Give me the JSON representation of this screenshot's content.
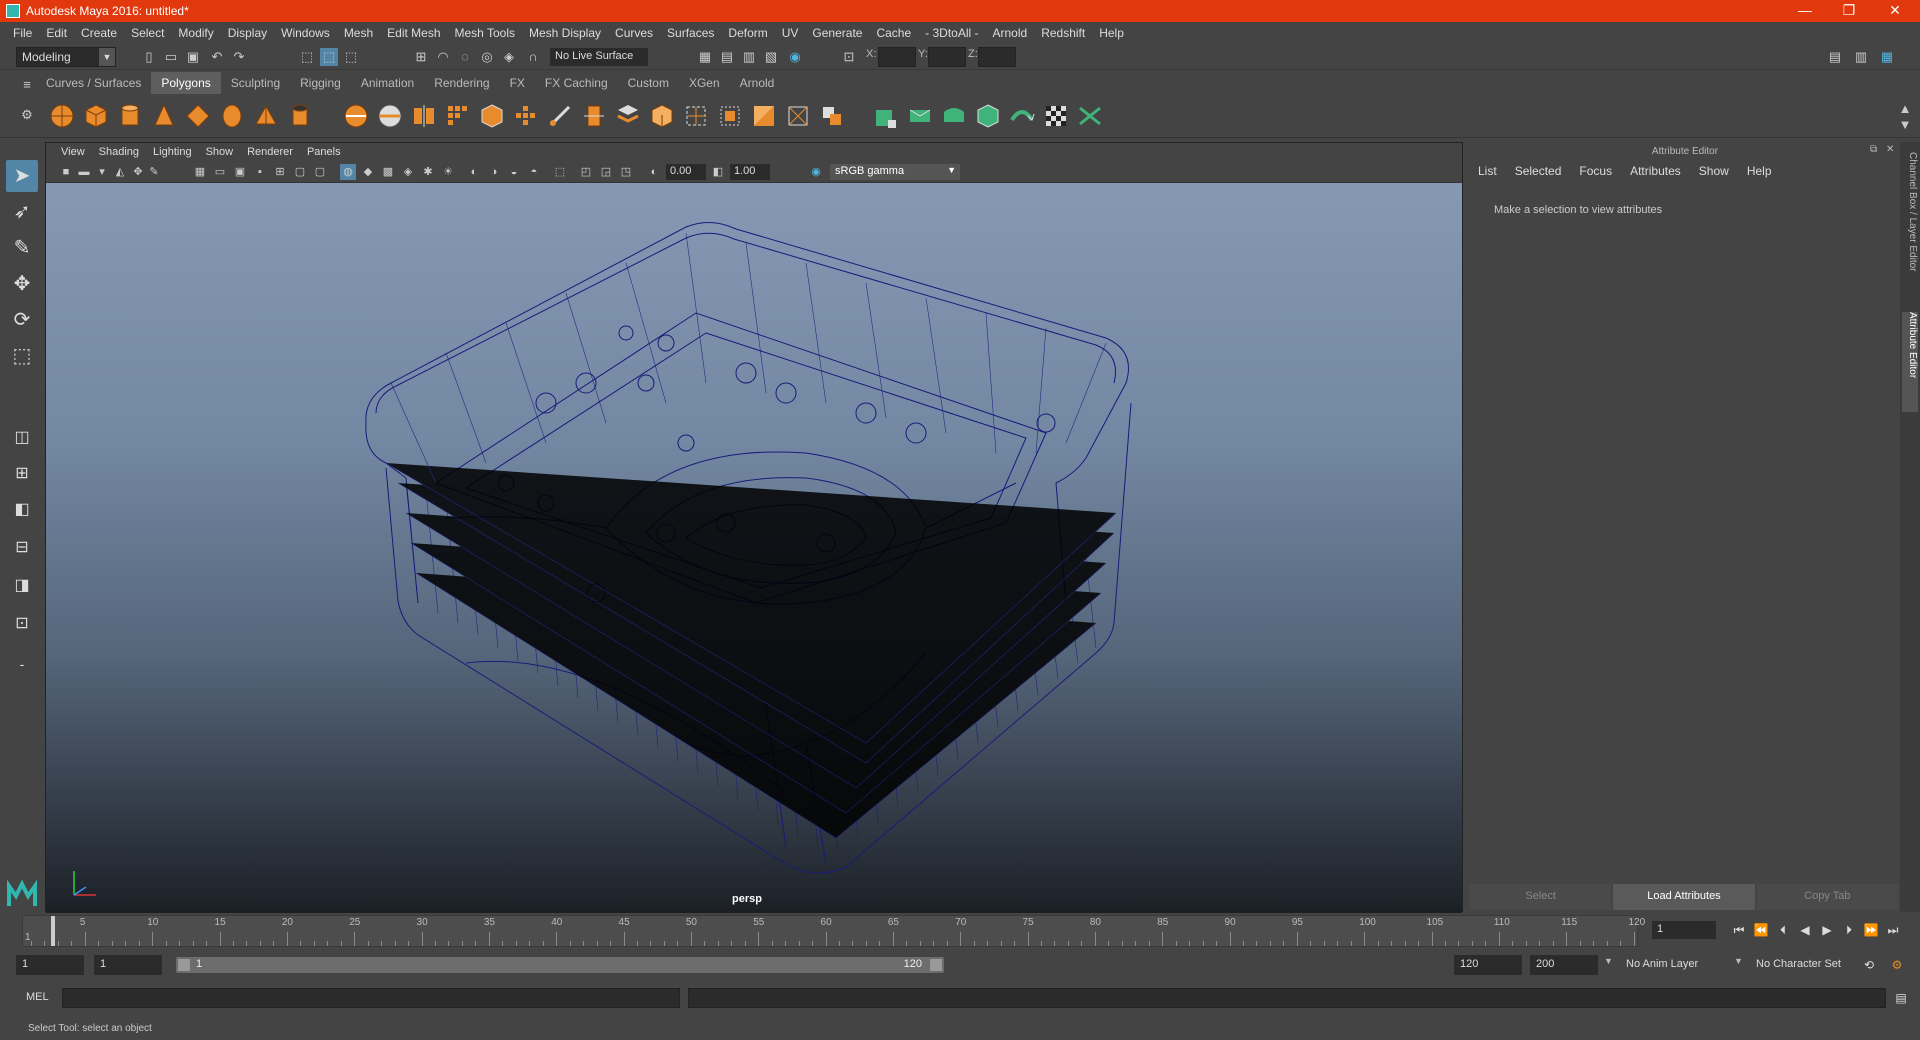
{
  "window": {
    "title": "Autodesk Maya 2016: untitled*",
    "minimize_glyph": "—",
    "restore_glyph": "❐",
    "close_glyph": "✕"
  },
  "menubar": [
    "File",
    "Edit",
    "Create",
    "Select",
    "Modify",
    "Display",
    "Windows",
    "Mesh",
    "Edit Mesh",
    "Mesh Tools",
    "Mesh Display",
    "Curves",
    "Surfaces",
    "Deform",
    "UV",
    "Generate",
    "Cache",
    "- 3DtoAll -",
    "Arnold",
    "Redshift",
    "Help"
  ],
  "statusline": {
    "mode": "Modeling",
    "live_surface": "No Live Surface",
    "x_label": "X:",
    "y_label": "Y:",
    "z_label": "Z:"
  },
  "shelf": {
    "tabs": [
      "Curves / Surfaces",
      "Polygons",
      "Sculpting",
      "Rigging",
      "Animation",
      "Rendering",
      "FX",
      "FX Caching",
      "Custom",
      "XGen",
      "Arnold"
    ],
    "active_tab": "Polygons"
  },
  "viewport": {
    "menu": [
      "View",
      "Shading",
      "Lighting",
      "Show",
      "Renderer",
      "Panels"
    ],
    "exposure": "0.00",
    "gamma": "1.00",
    "color_space": "sRGB gamma",
    "camera": "persp"
  },
  "attribute_editor": {
    "title": "Attribute Editor",
    "menu": [
      "List",
      "Selected",
      "Focus",
      "Attributes",
      "Show",
      "Help"
    ],
    "message": "Make a selection to view attributes",
    "buttons": [
      "Select",
      "Load Attributes",
      "Copy Tab"
    ]
  },
  "side_tabs": [
    "Channel Box / Layer Editor",
    "Attribute Editor"
  ],
  "timeline": {
    "ticks": [
      "5",
      "10",
      "15",
      "20",
      "25",
      "30",
      "35",
      "40",
      "45",
      "50",
      "55",
      "60",
      "65",
      "70",
      "75",
      "80",
      "85",
      "90",
      "95",
      "100",
      "105",
      "110",
      "115",
      "120"
    ],
    "current_frame": "1",
    "start_marker": "1"
  },
  "range": {
    "start": "1",
    "playback_start": "1",
    "slider_start": "1",
    "slider_end": "120",
    "playback_end": "120",
    "end": "200",
    "anim_layer": "No Anim Layer",
    "character_set": "No Character Set"
  },
  "command_line": {
    "label": "MEL"
  },
  "help_line": "Select Tool: select an object",
  "colors": {
    "title_bar": "#e1380e",
    "wireframe": "#1a1a7a",
    "accent": "#5285a6"
  }
}
